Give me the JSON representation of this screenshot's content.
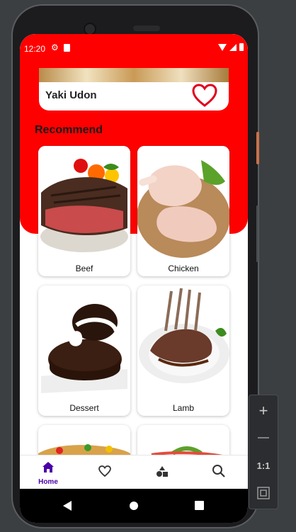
{
  "status_bar": {
    "time": "12:20"
  },
  "featured": {
    "name": "Yaki Udon"
  },
  "section": {
    "title": "Recommend"
  },
  "categories": [
    {
      "label": "Beef"
    },
    {
      "label": "Chicken"
    },
    {
      "label": "Dessert"
    },
    {
      "label": "Lamb"
    }
  ],
  "bottom_nav": {
    "items": [
      {
        "label": "Home",
        "icon": "home-icon",
        "active": true
      },
      {
        "label": "",
        "icon": "heart-icon"
      },
      {
        "label": "",
        "icon": "shapes-icon"
      },
      {
        "label": "",
        "icon": "search-icon"
      }
    ]
  },
  "emulator_controls": {
    "zoom_in": "+",
    "zoom_out": "—",
    "actual_size": "1:1"
  },
  "colors": {
    "header_red": "#ff0000",
    "accent_purple": "#4a00a8"
  }
}
